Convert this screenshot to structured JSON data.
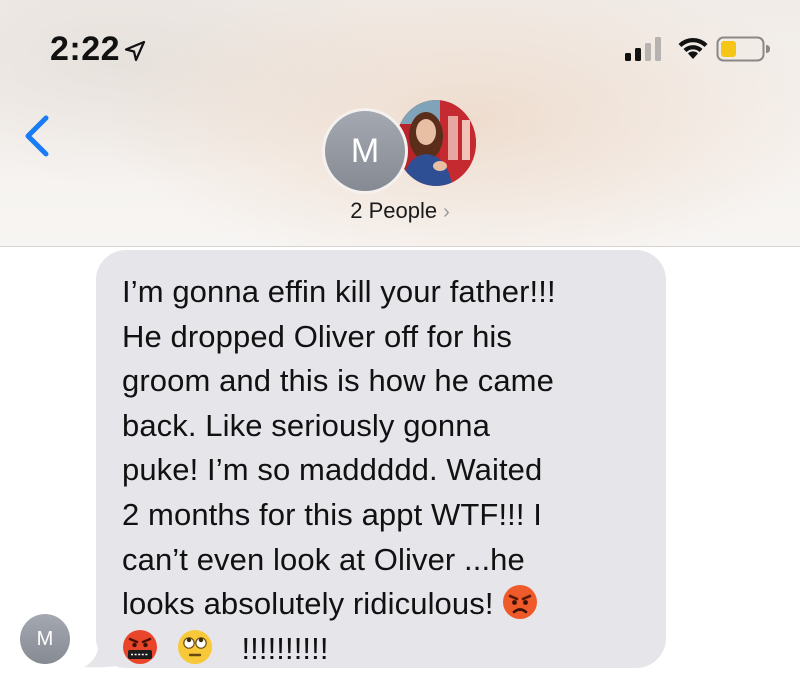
{
  "status_bar": {
    "time": "2:22",
    "icons": [
      "location-arrow-icon",
      "cellular-signal-icon",
      "wifi-icon",
      "battery-icon"
    ],
    "battery_color": "#f5c518"
  },
  "header": {
    "back_icon": "chevron-left-icon",
    "back_color": "#1a7cf5",
    "avatar_initial": "M",
    "title": "2 People",
    "title_chevron": "›"
  },
  "message": {
    "sender_initial": "M",
    "bubble_color": "#e5e5ea",
    "lines": [
      "I’m gonna effin kill your father!!!",
      "He dropped Oliver off for his",
      "groom and this is how he came",
      "back. Like seriously gonna",
      "puke! I’m so maddddd. Waited",
      "2 months for this appt WTF!!! I",
      "can’t even look at Oliver ...he",
      "looks absolutely ridiculous!"
    ],
    "last_line_text": "!!!!!!!!!!",
    "emojis": [
      "angry-face-icon",
      "cursing-face-icon",
      "eye-roll-face-icon"
    ]
  }
}
